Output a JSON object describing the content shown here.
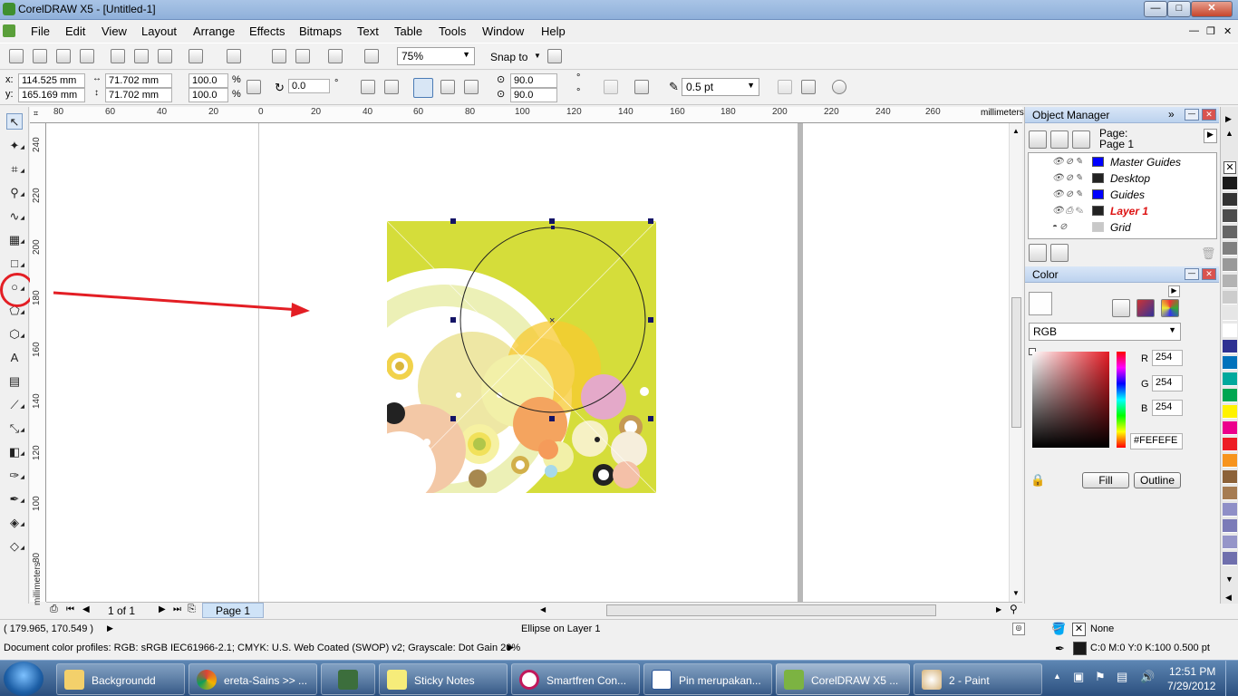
{
  "window": {
    "title": "CorelDRAW X5 - [Untitled-1]",
    "min": "—",
    "max": "□",
    "close": "✕",
    "doc_min": "—",
    "doc_restore": "❐",
    "doc_close": "✕"
  },
  "menu": [
    "File",
    "Edit",
    "View",
    "Layout",
    "Arrange",
    "Effects",
    "Bitmaps",
    "Text",
    "Table",
    "Tools",
    "Window",
    "Help"
  ],
  "standard_bar": {
    "zoom": "75%",
    "snap_to": "Snap to"
  },
  "property_bar": {
    "x_label": "x:",
    "x": "114.525 mm",
    "y_label": "y:",
    "y": "165.169 mm",
    "width": "71.702 mm",
    "height": "71.702 mm",
    "scale_w": "100.0",
    "scale_h": "100.0",
    "pct": "%",
    "rotation": "0.0",
    "deg": "°",
    "start_angle": "90.0",
    "end_angle": "90.0",
    "outline": "0.5 pt"
  },
  "ruler": {
    "h_ticks": [
      "80",
      "60",
      "40",
      "20",
      "0",
      "20",
      "40",
      "60",
      "80",
      "100",
      "120",
      "140",
      "160",
      "180",
      "200",
      "220",
      "240",
      "260"
    ],
    "unit": "millimeters",
    "v_ticks": [
      "240",
      "220",
      "200",
      "180",
      "160",
      "140",
      "120",
      "100",
      "80"
    ]
  },
  "page_nav": {
    "count": "1 of 1",
    "tab": "Page 1"
  },
  "status": {
    "coords": "( 179.965, 170.549 )",
    "object": "Ellipse on Layer 1",
    "profiles": "Document color profiles: RGB: sRGB IEC61966-2.1; CMYK: U.S. Web Coated (SWOP) v2; Grayscale: Dot Gain 20%",
    "fill": "None",
    "outline": "C:0 M:0 Y:0 K:100  0.500 pt"
  },
  "object_manager": {
    "title": "Object Manager",
    "page_label": "Page:",
    "page_name": "Page 1",
    "layers": [
      {
        "name": "Master Guides",
        "color": "#0000ff",
        "active": false
      },
      {
        "name": "Desktop",
        "color": "#222222",
        "active": false
      },
      {
        "name": "Guides",
        "color": "#0000ff",
        "active": false
      },
      {
        "name": "Layer 1",
        "color": "#222222",
        "active": true
      },
      {
        "name": "Grid",
        "color": "#c8c8c8",
        "active": false
      }
    ]
  },
  "color_docker": {
    "title": "Color",
    "model": "RGB",
    "r_label": "R",
    "r": "254",
    "g_label": "G",
    "g": "254",
    "b_label": "B",
    "b": "254",
    "hex": "#FEFEFE",
    "fill_btn": "Fill",
    "outline_btn": "Outline"
  },
  "palette_colors": [
    "#1a1a1a",
    "#333333",
    "#4d4d4d",
    "#666666",
    "#808080",
    "#999999",
    "#b3b3b3",
    "#cccccc",
    "#e6e6e6",
    "#ffffff",
    "#2e3192",
    "#0072bc",
    "#00a99d",
    "#00a651",
    "#fff200",
    "#ec008c",
    "#ed1c24",
    "#f7941d",
    "#8c6239",
    "#a67c52",
    "#8f8fc7",
    "#7b7bb8",
    "#9595c9",
    "#6f6fad"
  ],
  "taskbar": {
    "items": [
      "Backgroundd",
      "ereta-Sains >> ...",
      "",
      "Sticky Notes",
      "Smartfren Con...",
      "Pin merupakan...",
      "CorelDRAW X5 ...",
      "2 - Paint"
    ],
    "time": "12:51 PM",
    "date": "7/29/2012"
  },
  "colors": {
    "accent_red": "#e31e24",
    "page_bg": "#d5dd3a",
    "title_bar": "#a9c4e6"
  }
}
